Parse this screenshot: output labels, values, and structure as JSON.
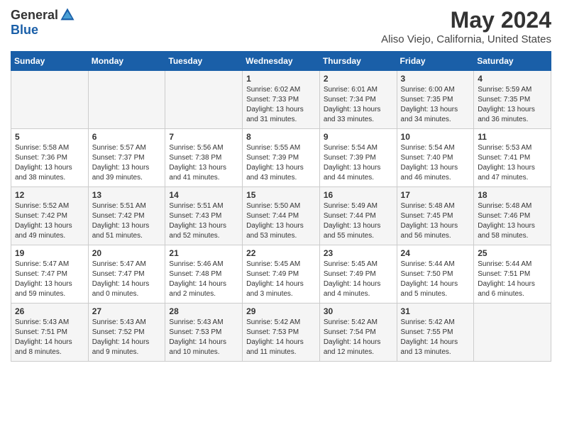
{
  "logo": {
    "general": "General",
    "blue": "Blue"
  },
  "title": {
    "month": "May 2024",
    "location": "Aliso Viejo, California, United States"
  },
  "days_of_week": [
    "Sunday",
    "Monday",
    "Tuesday",
    "Wednesday",
    "Thursday",
    "Friday",
    "Saturday"
  ],
  "weeks": [
    [
      {
        "day": "",
        "info": ""
      },
      {
        "day": "",
        "info": ""
      },
      {
        "day": "",
        "info": ""
      },
      {
        "day": "1",
        "info": "Sunrise: 6:02 AM\nSunset: 7:33 PM\nDaylight: 13 hours\nand 31 minutes."
      },
      {
        "day": "2",
        "info": "Sunrise: 6:01 AM\nSunset: 7:34 PM\nDaylight: 13 hours\nand 33 minutes."
      },
      {
        "day": "3",
        "info": "Sunrise: 6:00 AM\nSunset: 7:35 PM\nDaylight: 13 hours\nand 34 minutes."
      },
      {
        "day": "4",
        "info": "Sunrise: 5:59 AM\nSunset: 7:35 PM\nDaylight: 13 hours\nand 36 minutes."
      }
    ],
    [
      {
        "day": "5",
        "info": "Sunrise: 5:58 AM\nSunset: 7:36 PM\nDaylight: 13 hours\nand 38 minutes."
      },
      {
        "day": "6",
        "info": "Sunrise: 5:57 AM\nSunset: 7:37 PM\nDaylight: 13 hours\nand 39 minutes."
      },
      {
        "day": "7",
        "info": "Sunrise: 5:56 AM\nSunset: 7:38 PM\nDaylight: 13 hours\nand 41 minutes."
      },
      {
        "day": "8",
        "info": "Sunrise: 5:55 AM\nSunset: 7:39 PM\nDaylight: 13 hours\nand 43 minutes."
      },
      {
        "day": "9",
        "info": "Sunrise: 5:54 AM\nSunset: 7:39 PM\nDaylight: 13 hours\nand 44 minutes."
      },
      {
        "day": "10",
        "info": "Sunrise: 5:54 AM\nSunset: 7:40 PM\nDaylight: 13 hours\nand 46 minutes."
      },
      {
        "day": "11",
        "info": "Sunrise: 5:53 AM\nSunset: 7:41 PM\nDaylight: 13 hours\nand 47 minutes."
      }
    ],
    [
      {
        "day": "12",
        "info": "Sunrise: 5:52 AM\nSunset: 7:42 PM\nDaylight: 13 hours\nand 49 minutes."
      },
      {
        "day": "13",
        "info": "Sunrise: 5:51 AM\nSunset: 7:42 PM\nDaylight: 13 hours\nand 51 minutes."
      },
      {
        "day": "14",
        "info": "Sunrise: 5:51 AM\nSunset: 7:43 PM\nDaylight: 13 hours\nand 52 minutes."
      },
      {
        "day": "15",
        "info": "Sunrise: 5:50 AM\nSunset: 7:44 PM\nDaylight: 13 hours\nand 53 minutes."
      },
      {
        "day": "16",
        "info": "Sunrise: 5:49 AM\nSunset: 7:44 PM\nDaylight: 13 hours\nand 55 minutes."
      },
      {
        "day": "17",
        "info": "Sunrise: 5:48 AM\nSunset: 7:45 PM\nDaylight: 13 hours\nand 56 minutes."
      },
      {
        "day": "18",
        "info": "Sunrise: 5:48 AM\nSunset: 7:46 PM\nDaylight: 13 hours\nand 58 minutes."
      }
    ],
    [
      {
        "day": "19",
        "info": "Sunrise: 5:47 AM\nSunset: 7:47 PM\nDaylight: 13 hours\nand 59 minutes."
      },
      {
        "day": "20",
        "info": "Sunrise: 5:47 AM\nSunset: 7:47 PM\nDaylight: 14 hours\nand 0 minutes."
      },
      {
        "day": "21",
        "info": "Sunrise: 5:46 AM\nSunset: 7:48 PM\nDaylight: 14 hours\nand 2 minutes."
      },
      {
        "day": "22",
        "info": "Sunrise: 5:45 AM\nSunset: 7:49 PM\nDaylight: 14 hours\nand 3 minutes."
      },
      {
        "day": "23",
        "info": "Sunrise: 5:45 AM\nSunset: 7:49 PM\nDaylight: 14 hours\nand 4 minutes."
      },
      {
        "day": "24",
        "info": "Sunrise: 5:44 AM\nSunset: 7:50 PM\nDaylight: 14 hours\nand 5 minutes."
      },
      {
        "day": "25",
        "info": "Sunrise: 5:44 AM\nSunset: 7:51 PM\nDaylight: 14 hours\nand 6 minutes."
      }
    ],
    [
      {
        "day": "26",
        "info": "Sunrise: 5:43 AM\nSunset: 7:51 PM\nDaylight: 14 hours\nand 8 minutes."
      },
      {
        "day": "27",
        "info": "Sunrise: 5:43 AM\nSunset: 7:52 PM\nDaylight: 14 hours\nand 9 minutes."
      },
      {
        "day": "28",
        "info": "Sunrise: 5:43 AM\nSunset: 7:53 PM\nDaylight: 14 hours\nand 10 minutes."
      },
      {
        "day": "29",
        "info": "Sunrise: 5:42 AM\nSunset: 7:53 PM\nDaylight: 14 hours\nand 11 minutes."
      },
      {
        "day": "30",
        "info": "Sunrise: 5:42 AM\nSunset: 7:54 PM\nDaylight: 14 hours\nand 12 minutes."
      },
      {
        "day": "31",
        "info": "Sunrise: 5:42 AM\nSunset: 7:55 PM\nDaylight: 14 hours\nand 13 minutes."
      },
      {
        "day": "",
        "info": ""
      }
    ]
  ]
}
